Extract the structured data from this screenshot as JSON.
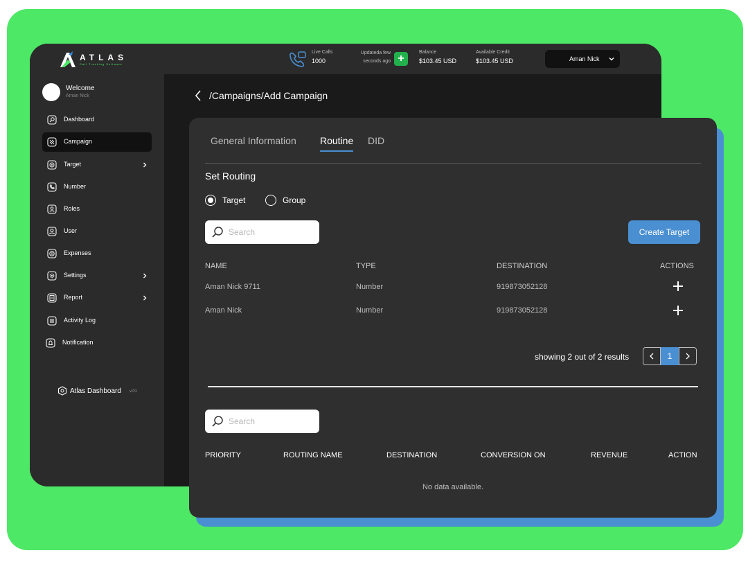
{
  "brand": {
    "name": "ATLAS",
    "tagline": "Call Tracking Software",
    "green": "#4de865",
    "accent": "#4a8fd1"
  },
  "topbar": {
    "live_calls_label": "Live Calls",
    "live_calls_value": "1000",
    "updated_line1": "Updateda few",
    "updated_line2": "seconds ago",
    "balance_label": "Balance",
    "balance_value": "$103.45 USD",
    "credit_label": "Available Credit",
    "credit_value": "$103.45 USD",
    "user_name": "Aman Nick"
  },
  "sidebar": {
    "welcome_title": "Welcome",
    "welcome_user": "Aman Nick",
    "items": [
      {
        "label": "Dashboard",
        "icon": "dashboard-icon"
      },
      {
        "label": "Campaign",
        "icon": "campaign-icon",
        "active": true
      },
      {
        "label": "Target",
        "icon": "target-icon",
        "has_submenu": true
      },
      {
        "label": "Number",
        "icon": "phone-icon"
      },
      {
        "label": "Roles",
        "icon": "roles-icon"
      },
      {
        "label": "User",
        "icon": "user-icon"
      },
      {
        "label": "Expenses",
        "icon": "expenses-icon"
      },
      {
        "label": "Settings",
        "icon": "settings-icon",
        "has_submenu": true
      },
      {
        "label": "Report",
        "icon": "report-icon",
        "has_submenu": true
      },
      {
        "label": "Activity Log",
        "icon": "activity-log-icon"
      },
      {
        "label": "Notification",
        "icon": "bell-icon"
      }
    ],
    "footer_label": "Atlas Dashboard",
    "footer_version": "v.01"
  },
  "breadcrumb": "/Campaigns/Add Campaign",
  "tabs": [
    {
      "label": "General Information",
      "active": false
    },
    {
      "label": "Routine",
      "active": true
    },
    {
      "label": "DID",
      "active": false
    }
  ],
  "routing": {
    "title": "Set Routing",
    "options": [
      {
        "label": "Target",
        "selected": true
      },
      {
        "label": "Group",
        "selected": false
      }
    ],
    "search_placeholder": "Search",
    "create_button": "Create Target",
    "columns": [
      "NAME",
      "TYPE",
      "DESTINATION",
      "ACTIONS"
    ],
    "rows": [
      {
        "name": "Aman Nick 9711",
        "type": "Number",
        "destination": "919873052128"
      },
      {
        "name": "Aman Nick",
        "type": "Number",
        "destination": "919873052128"
      }
    ],
    "pagination_text": "showing 2 out of 2 results",
    "current_page": "1"
  },
  "priority_table": {
    "search_placeholder": "Search",
    "columns": [
      "PRIORITY",
      "ROUTING NAME",
      "DESTINATION",
      "CONVERSION ON",
      "REVENUE",
      "ACTION"
    ],
    "empty_text": "No data available."
  }
}
